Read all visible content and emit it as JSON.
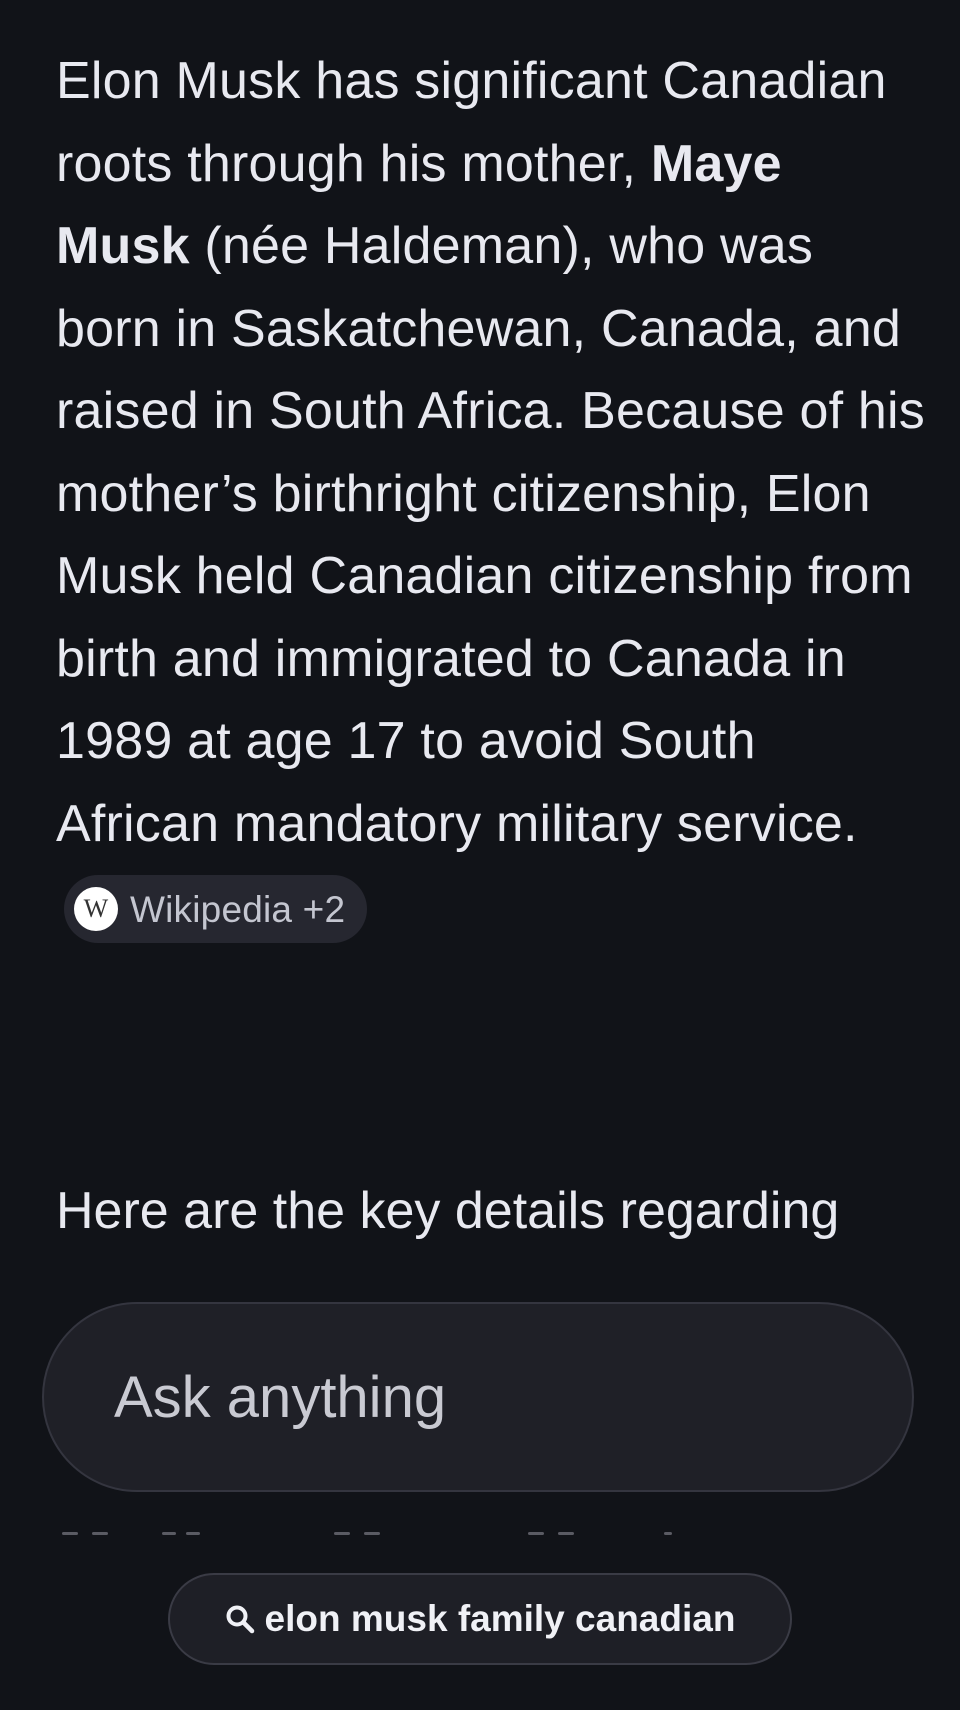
{
  "answer": {
    "p1_before": "Elon Musk has significant Canadian roots through his mother, ",
    "p1_bold": "Maye Musk",
    "p1_after": " (née Haldeman), who was born in Saskatchewan, Canada, and raised in South Africa. Because of his mother’s birthright citizenship, Elon Musk held Canadian citizenship from birth and immigrated to Canada in 1989 at age 17 to avoid South African mandatory military service.",
    "source_chip": {
      "icon": "wikipedia-icon",
      "badge_letter": "W",
      "label": "Wikipedia +2"
    },
    "p2": "Here are the key details regarding"
  },
  "ask_box": {
    "placeholder": "Ask anything"
  },
  "suggestion": {
    "icon": "search-icon",
    "label": "elon musk family canadian"
  },
  "colors": {
    "background": "#111318",
    "text": "#e8e9f0",
    "chip_bg": "#262730",
    "input_bg": "#1f2027"
  }
}
